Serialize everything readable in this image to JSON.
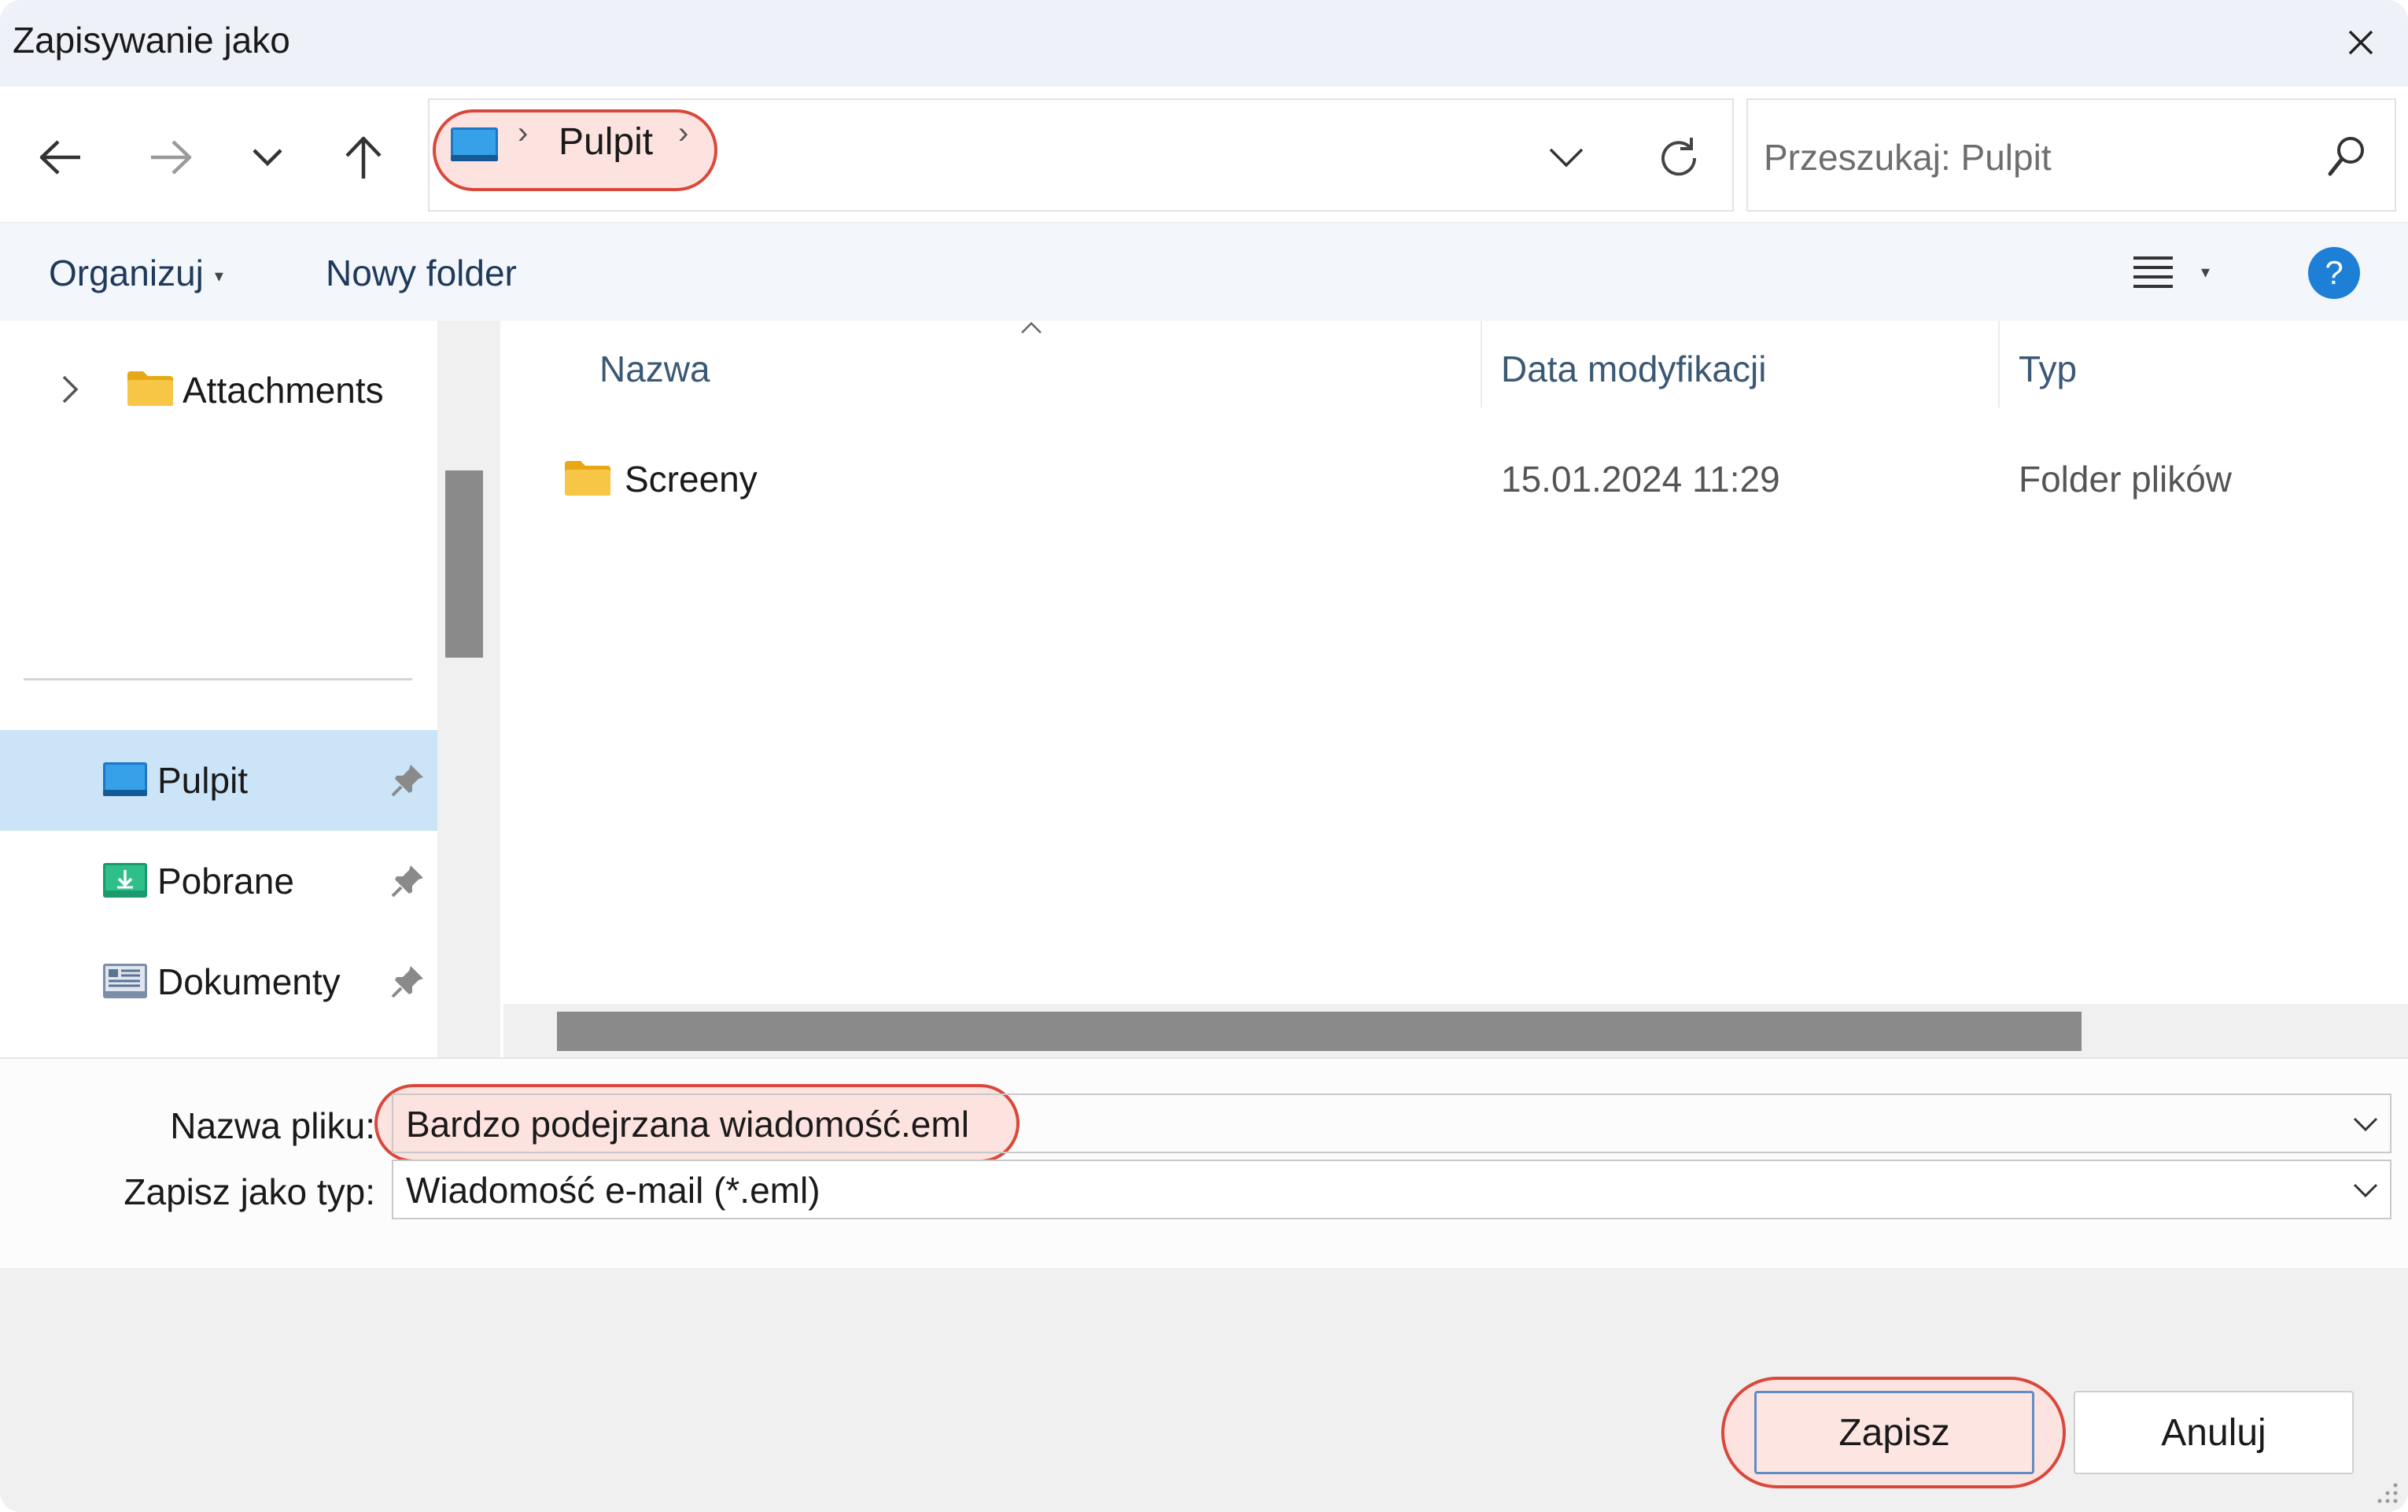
{
  "window": {
    "title": "Zapisywanie jako"
  },
  "address": {
    "crumb": "Pulpit"
  },
  "search": {
    "placeholder": "Przeszukaj: Pulpit"
  },
  "toolbar": {
    "organize_label": "Organizuj",
    "new_folder_label": "Nowy folder"
  },
  "sidebar": {
    "items": [
      {
        "label": "Attachments",
        "icon": "folder-icon",
        "expandable": true
      },
      {
        "label": "Pulpit",
        "icon": "desktop-icon",
        "pinned": true,
        "selected": true
      },
      {
        "label": "Pobrane",
        "icon": "downloads-icon",
        "pinned": true
      },
      {
        "label": "Dokumenty",
        "icon": "documents-icon",
        "pinned": true
      }
    ]
  },
  "columns": {
    "name": "Nazwa",
    "modified": "Data modyfikacji",
    "type": "Typ"
  },
  "files": [
    {
      "name": "Screeny",
      "modified": "15.01.2024 11:29",
      "type": "Folder plików",
      "icon": "folder-icon"
    }
  ],
  "form": {
    "filename_label": "Nazwa pliku:",
    "filename_value": "Bardzo podejrzana wiadomość.eml",
    "filetype_label": "Zapisz jako typ:",
    "filetype_value": "Wiadomość e-mail (*.eml)"
  },
  "buttons": {
    "save": "Zapisz",
    "cancel": "Anuluj"
  },
  "colors": {
    "highlight": "#d9483b",
    "selected": "#cce4f7",
    "help": "#1e7fd6",
    "folder": "#f6c244"
  }
}
